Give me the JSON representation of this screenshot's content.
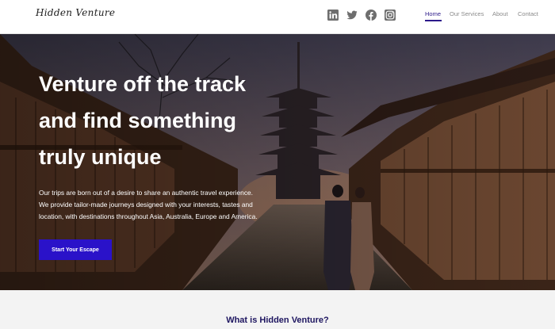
{
  "header": {
    "logo_text": "Hidden Venture",
    "social": [
      {
        "icon": "linkedin-icon"
      },
      {
        "icon": "twitter-icon"
      },
      {
        "icon": "facebook-icon"
      },
      {
        "icon": "instagram-icon"
      }
    ],
    "nav": [
      {
        "label": "Home",
        "active": true
      },
      {
        "label": "Our Services",
        "active": false
      },
      {
        "label": "About",
        "active": false
      },
      {
        "label": "Contact",
        "active": false
      }
    ]
  },
  "hero": {
    "title_lines": [
      "Venture off the track",
      "and find something",
      "truly unique"
    ],
    "paragraph_lines": [
      "Our trips are born out of a desire to share an authentic travel experience.",
      "We provide tailor-made journeys designed with your interests, tastes and",
      "location, with destinations throughout Asia, Australia, Europe and America."
    ],
    "cta_label": "Start Your Escape"
  },
  "section": {
    "title": "What is Hidden Venture?"
  },
  "colors": {
    "accent": "#2a12c9",
    "nav_active": "#2c1a8a",
    "section_title": "#1e1660"
  }
}
